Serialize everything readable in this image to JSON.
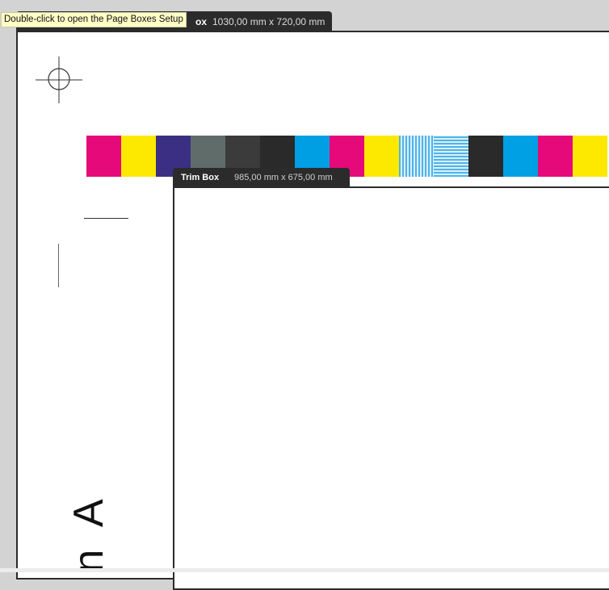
{
  "tooltip": {
    "text": "Double-click to open the Page Boxes Setup"
  },
  "media_box": {
    "name": "Media Box",
    "name_visible": "ox",
    "size": "1030,00 mm x 720,00 mm"
  },
  "trim_box": {
    "name": "Trim Box",
    "size": "985,00 mm x 675,00 mm"
  },
  "color_bar": {
    "swatches": [
      "#e6097a",
      "#fde800",
      "#3b2f84",
      "#5f6c6a",
      "#3b3b3b",
      "#2a2a2a",
      "#009fe3",
      "#e6097a",
      "#fde800",
      "stripes-v",
      "stripes-h",
      "#2a2a2a",
      "#00a0e4",
      "#e6097a",
      "#fde800"
    ]
  },
  "artwork": {
    "rotated_text": "n A"
  },
  "colors": {
    "tab_bg": "#2b2b2b",
    "tooltip_bg": "#fdfdc6",
    "canvas_bg": "#d3d3d3"
  }
}
